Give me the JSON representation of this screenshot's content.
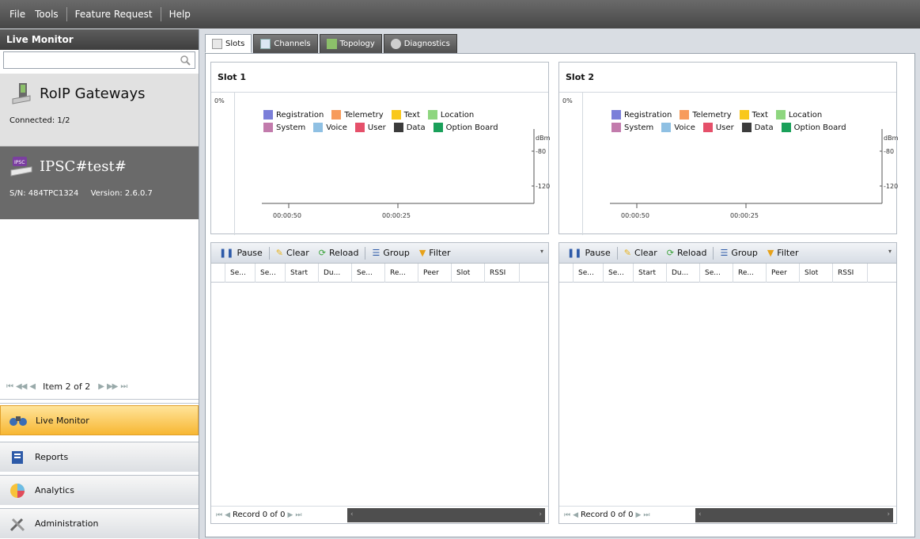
{
  "menu": {
    "file": "File",
    "tools": "Tools",
    "feature_request": "Feature Request",
    "help": "Help"
  },
  "sidebar": {
    "header": "Live Monitor",
    "search_placeholder": "",
    "gateways": {
      "title": "RoIP Gateways",
      "connected": "Connected: 1/2"
    },
    "device": {
      "badge": "IPSC",
      "title": "IPSC#test#",
      "serial": "S/N: 484TPC1324",
      "version": "Version: 2.6.0.7"
    },
    "pager": {
      "text": "Item 2 of 2"
    },
    "nav": [
      {
        "label": "Live Monitor"
      },
      {
        "label": "Reports"
      },
      {
        "label": "Analytics"
      },
      {
        "label": "Administration"
      }
    ]
  },
  "tabs": [
    {
      "label": "Slots"
    },
    {
      "label": "Channels"
    },
    {
      "label": "Topology"
    },
    {
      "label": "Diagnostics"
    }
  ],
  "legend": [
    {
      "label": "Registration",
      "color": "#7b7fd9"
    },
    {
      "label": "Telemetry",
      "color": "#f79b5c"
    },
    {
      "label": "Text",
      "color": "#f9c81a"
    },
    {
      "label": "Location",
      "color": "#8ed67f"
    },
    {
      "label": "System",
      "color": "#c27bac"
    },
    {
      "label": "Voice",
      "color": "#8fc0e3"
    },
    {
      "label": "User",
      "color": "#e5506a"
    },
    {
      "label": "Data",
      "color": "#3b3b3b"
    },
    {
      "label": "Option Board",
      "color": "#1aa05a"
    }
  ],
  "chart_axis": {
    "pct": "0%",
    "unit": "dBm",
    "y1": "-80",
    "y2": "-120",
    "x1": "00:00:50",
    "x2": "00:00:25"
  },
  "toolbar": {
    "pause": "Pause",
    "clear": "Clear",
    "reload": "Reload",
    "group": "Group",
    "filter": "Filter"
  },
  "columns": [
    "Se...",
    "Se...",
    "Start",
    "Du...",
    "Se...",
    "Re...",
    "Peer",
    "Slot",
    "RSSI"
  ],
  "record": "Record 0 of 0",
  "slots": [
    {
      "title": "Slot 1"
    },
    {
      "title": "Slot 2"
    }
  ]
}
